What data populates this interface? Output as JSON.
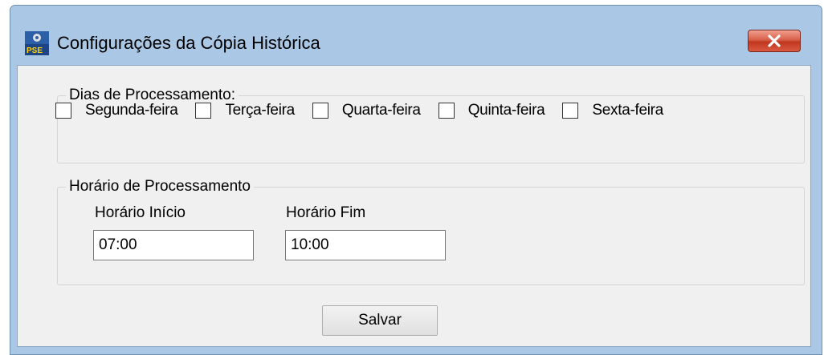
{
  "window": {
    "title": "Configurações da Cópia Histórica",
    "app_icon": "pse-app-icon",
    "close_icon": "close-icon"
  },
  "processing_days": {
    "legend": "Dias de Processamento:",
    "days": [
      {
        "label": "Segunda-feira",
        "checked": false
      },
      {
        "label": "Terça-feira",
        "checked": false
      },
      {
        "label": "Quarta-feira",
        "checked": false
      },
      {
        "label": "Quinta-feira",
        "checked": false
      },
      {
        "label": "Sexta-feira",
        "checked": false
      }
    ]
  },
  "processing_time": {
    "legend": "Horário de Processamento",
    "start_label": "Horário Início",
    "start_value": "07:00",
    "end_label": "Horário Fim",
    "end_value": "10:00"
  },
  "actions": {
    "save_label": "Salvar"
  },
  "colors": {
    "frame": "#aac8e6",
    "client": "#f0f0f0",
    "close": "#c0371f"
  }
}
